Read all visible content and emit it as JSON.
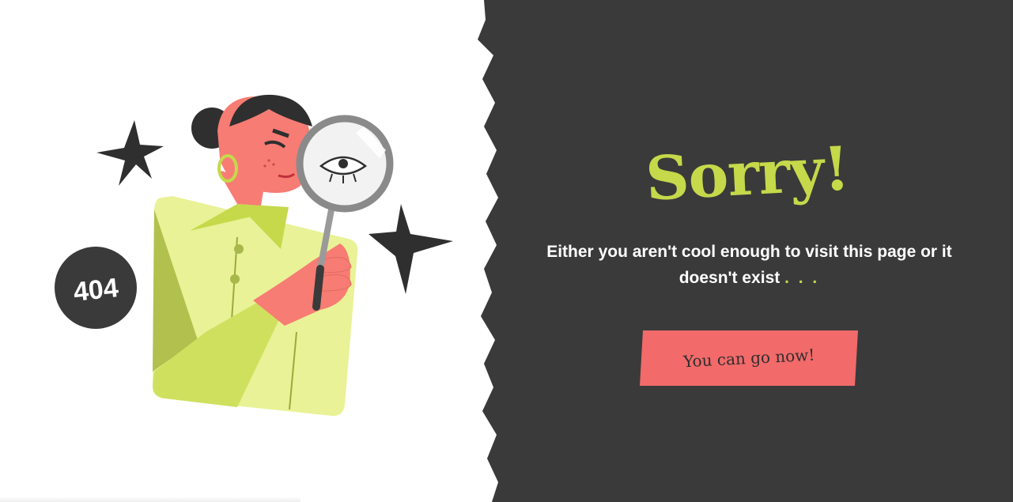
{
  "page": {
    "title": "Sorry!",
    "message": "Either you aren't cool enough to visit this page or it doesn't exist",
    "ellipsis": ". . .",
    "button_label": "You can go now!"
  },
  "illustration": {
    "badge_text": "404"
  },
  "colors": {
    "dark_background": "#3a3a3a",
    "accent_green": "#c5d94a",
    "button_coral": "#f26a6a",
    "skin_pink": "#f77c74"
  }
}
